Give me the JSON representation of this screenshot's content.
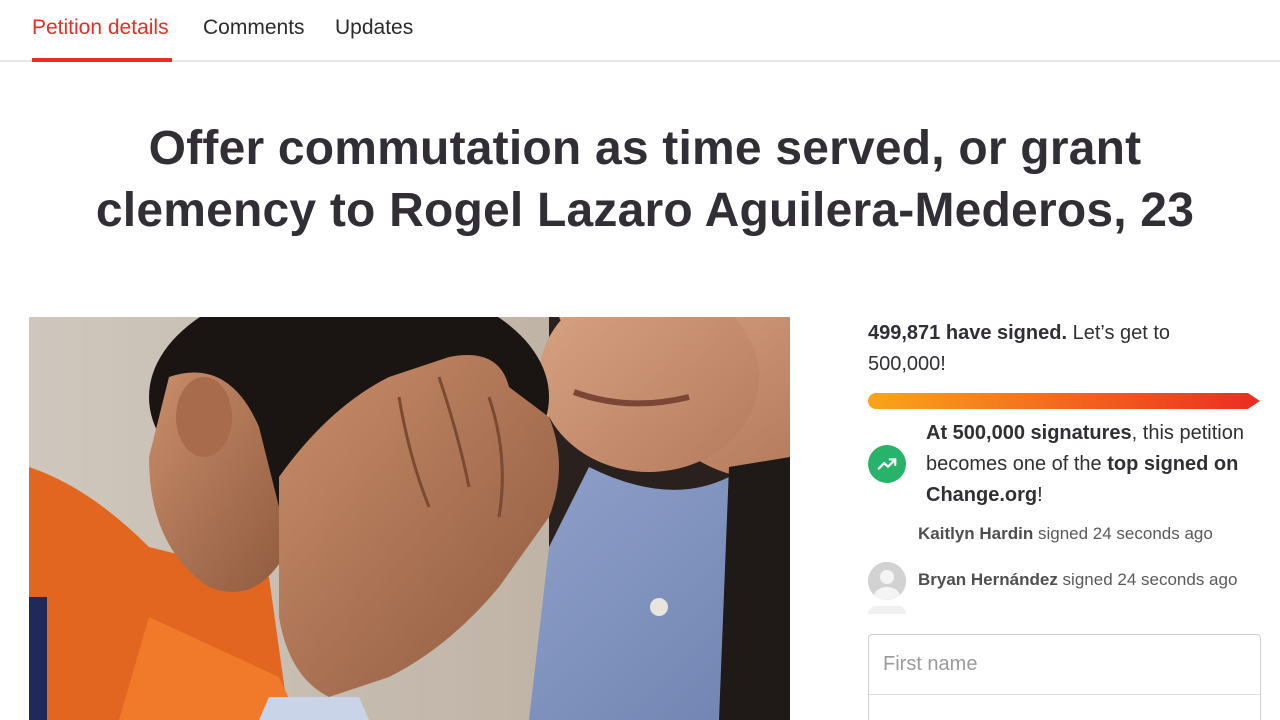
{
  "tabs": [
    {
      "label": "Petition details",
      "active": true
    },
    {
      "label": "Comments",
      "active": false
    },
    {
      "label": "Updates",
      "active": false
    }
  ],
  "title_line1": "Offer commutation as time served, or grant",
  "title_line2": "clemency to Rogel Lazaro Aguilera-Mederos, 23",
  "signatures": {
    "count_text": "499,871 have signed.",
    "goal_text_part": " Let’s get to",
    "goal_value": "500,000!",
    "progress_fraction": 0.99974
  },
  "milestone": {
    "bold1": "At 500,000 signatures",
    "text1": ", this petition becomes one of the ",
    "bold2": "top signed on Change.org",
    "text2": "!",
    "icon": "trending-up-icon"
  },
  "recent_signers": [
    {
      "name": "Kaitlyn Hardin",
      "action": " signed 24 seconds ago",
      "avatar": false
    },
    {
      "name": "Bryan Hernández",
      "action": " signed 24 seconds ago",
      "avatar": true
    }
  ],
  "form": {
    "first_name_placeholder": "First name"
  },
  "colors": {
    "accent_red": "#ec2c22",
    "progress_start": "#f9a51b",
    "progress_end": "#ec2c22",
    "milestone_green": "#27b36a"
  }
}
